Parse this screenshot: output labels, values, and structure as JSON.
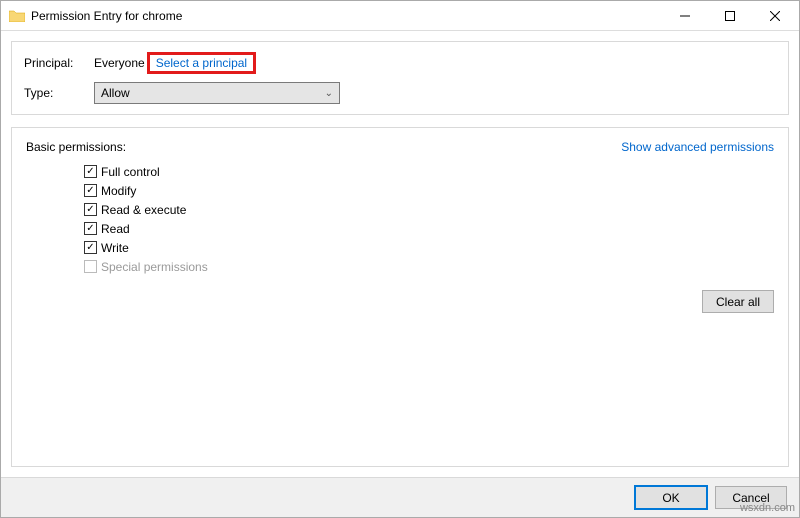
{
  "titlebar": {
    "title": "Permission Entry for chrome"
  },
  "principal": {
    "label": "Principal:",
    "value": "Everyone",
    "link": "Select a principal"
  },
  "type": {
    "label": "Type:",
    "value": "Allow"
  },
  "permissions": {
    "title": "Basic permissions:",
    "advanced_link": "Show advanced permissions",
    "items": [
      {
        "label": "Full control",
        "checked": true,
        "enabled": true
      },
      {
        "label": "Modify",
        "checked": true,
        "enabled": true
      },
      {
        "label": "Read & execute",
        "checked": true,
        "enabled": true
      },
      {
        "label": "Read",
        "checked": true,
        "enabled": true
      },
      {
        "label": "Write",
        "checked": true,
        "enabled": true
      },
      {
        "label": "Special permissions",
        "checked": false,
        "enabled": false
      }
    ],
    "clear_all": "Clear all"
  },
  "footer": {
    "ok": "OK",
    "cancel": "Cancel"
  },
  "watermark": "wsxdn.com"
}
